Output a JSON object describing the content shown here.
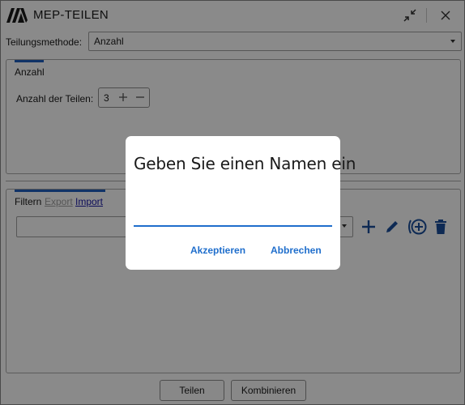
{
  "window": {
    "title": "MEP-TEILEN"
  },
  "method": {
    "label": "Teilungsmethode:",
    "value": "Anzahl"
  },
  "anzahl_group": {
    "tab_label": "Anzahl",
    "count_label": "Anzahl der Teilen:",
    "count_value": "3"
  },
  "filter_group": {
    "tabs": [
      {
        "label": "Filtern",
        "state": "active"
      },
      {
        "label": "Export",
        "state": "disabled"
      },
      {
        "label": "Import",
        "state": "link"
      }
    ],
    "filter_value": ""
  },
  "footer": {
    "split_label": "Teilen",
    "combine_label": "Kombinieren"
  },
  "dialog": {
    "title": "Geben Sie einen Namen ein",
    "input_value": "",
    "accept_label": "Akzeptieren",
    "cancel_label": "Abbrechen"
  },
  "colors": {
    "accent": "#1f6ecc",
    "tab_indicator": "#1f5fbf",
    "overlay": "rgba(0,0,0,0.46)"
  },
  "icons": [
    "app-logo-icon",
    "restore-icon",
    "close-icon",
    "plus-icon",
    "minus-icon",
    "add-icon",
    "edit-icon",
    "add-circle-icon",
    "delete-icon",
    "dropdown-arrow-icon"
  ]
}
